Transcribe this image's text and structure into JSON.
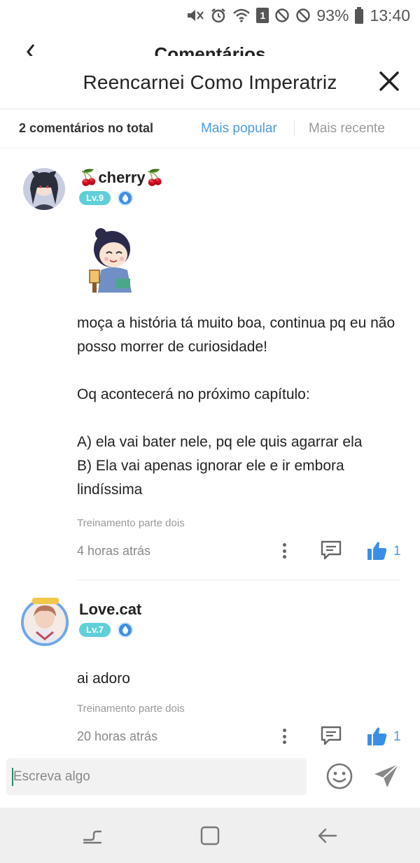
{
  "status_bar": {
    "battery": "93%",
    "time": "13:40",
    "sim_badge": "1",
    "icons": [
      "mute-icon",
      "alarm-icon",
      "wifi-icon",
      "sim-icon",
      "blocked-icon",
      "blocked-icon",
      "battery-icon"
    ]
  },
  "background_header": {
    "title": "Comentários"
  },
  "modal": {
    "title": "Reencarnei Como Imperatriz"
  },
  "sort_bar": {
    "total": "2 comentários no total",
    "popular": "Mais popular",
    "recent": "Mais recente",
    "active": "popular"
  },
  "comments": [
    {
      "username": "🍒cherry🍒",
      "level": "Lv.9",
      "text": "moça a história tá muito boa, continua pq eu não posso morrer de curiosidade!\n\nOq acontecerá no próximo capítulo:\n\nA) ela vai bater nele, pq ele quis agarrar ela\nB) Ela vai apenas ignorar ele e ir embora lindíssima",
      "chapter": "Treinamento parte dois",
      "time": "4 horas atrás",
      "likes": "1"
    },
    {
      "username": "Love.cat",
      "level": "Lv.7",
      "text": "ai adoro",
      "chapter": "Treinamento parte dois",
      "time": "20 horas atrás",
      "likes": "1"
    }
  ],
  "input": {
    "placeholder": "Escreva algo"
  },
  "colors": {
    "accent": "#4a9be0",
    "level_badge": "#5fcfd8",
    "like": "#3a8ee6"
  }
}
